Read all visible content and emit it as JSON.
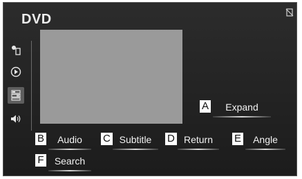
{
  "header": {
    "title": "DVD"
  },
  "sidebar": {
    "items": [
      {
        "icon": "settings-icon"
      },
      {
        "icon": "play-icon"
      },
      {
        "icon": "options-icon",
        "active": true
      },
      {
        "icon": "speaker-icon"
      }
    ]
  },
  "buttons": {
    "expand": {
      "callout": "A",
      "label": "Expand"
    },
    "audio": {
      "callout": "B",
      "label": "Audio"
    },
    "subtitle": {
      "callout": "C",
      "label": "Subtitle"
    },
    "return": {
      "callout": "D",
      "label": "Return"
    },
    "angle": {
      "callout": "E",
      "label": "Angle"
    },
    "search": {
      "callout": "F",
      "label": "Search"
    }
  },
  "colors": {
    "background": "#232323",
    "video_placeholder": "#9a9a9a",
    "text": "#f2f2f2",
    "active_tab": "#5e5e5e"
  }
}
